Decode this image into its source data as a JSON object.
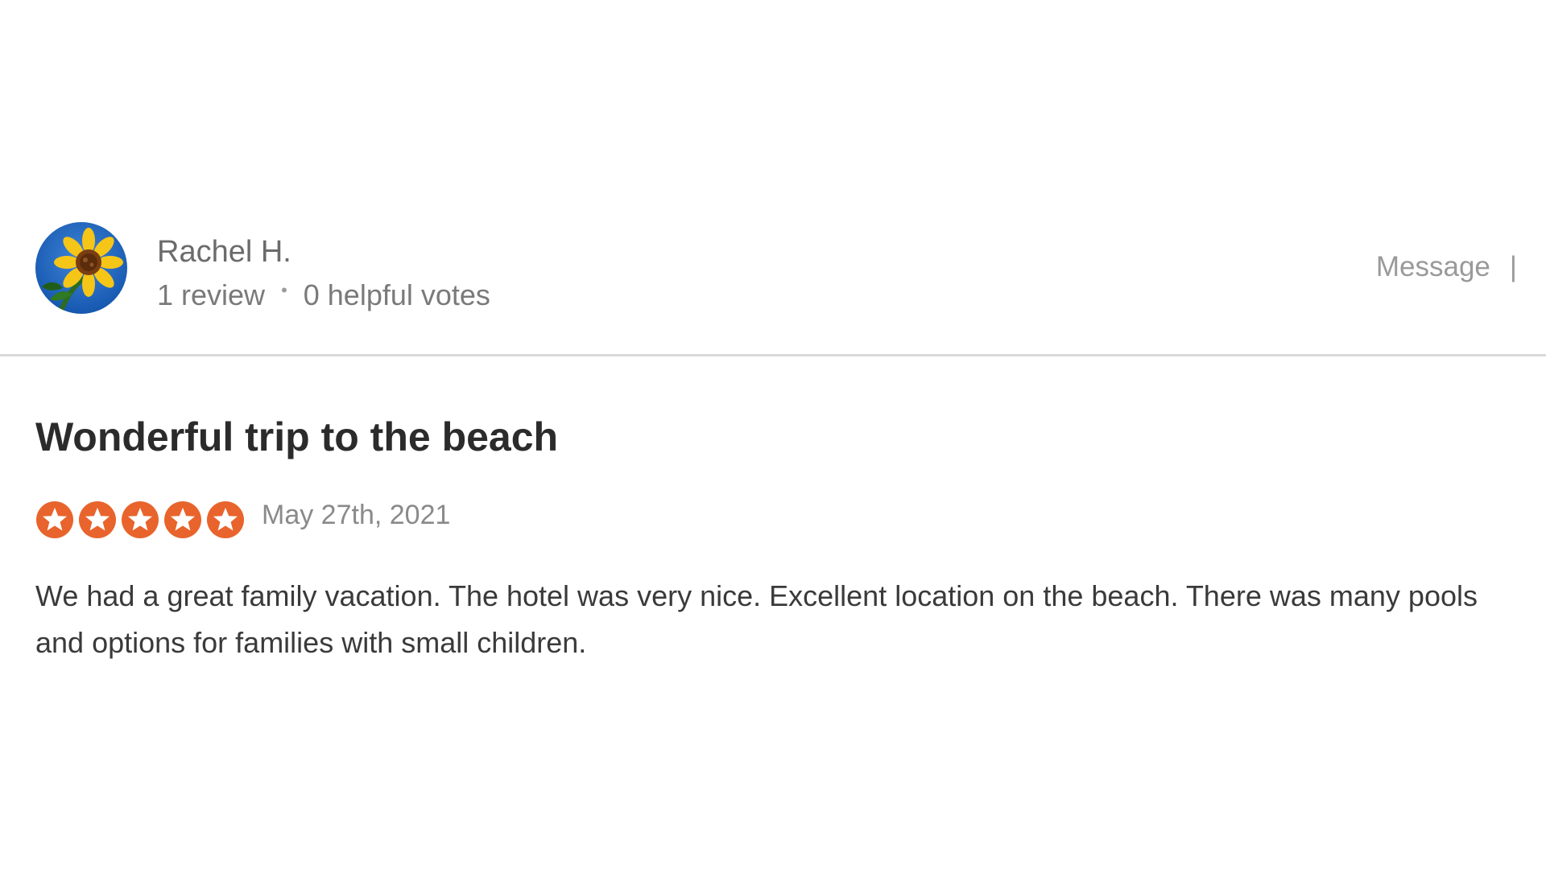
{
  "reviewer": {
    "avatar_icon": "sunflower-avatar",
    "name": "Rachel H.",
    "review_count": "1 review",
    "separator": "•",
    "helpful_votes": "0 helpful votes"
  },
  "actions": {
    "message_label": "Message",
    "separator": "|"
  },
  "review": {
    "title": "Wonderful trip to the beach",
    "rating": 5,
    "rating_max": 5,
    "date": "May 27th, 2021",
    "body": "We had a great family vacation. The hotel was very nice. Excellent location on the beach. There was many pools and options for families with small children."
  },
  "colors": {
    "star": "#e8642c",
    "title": "#2b2b2b",
    "muted": "#7a7a7a",
    "divider": "#d9d9d9"
  }
}
